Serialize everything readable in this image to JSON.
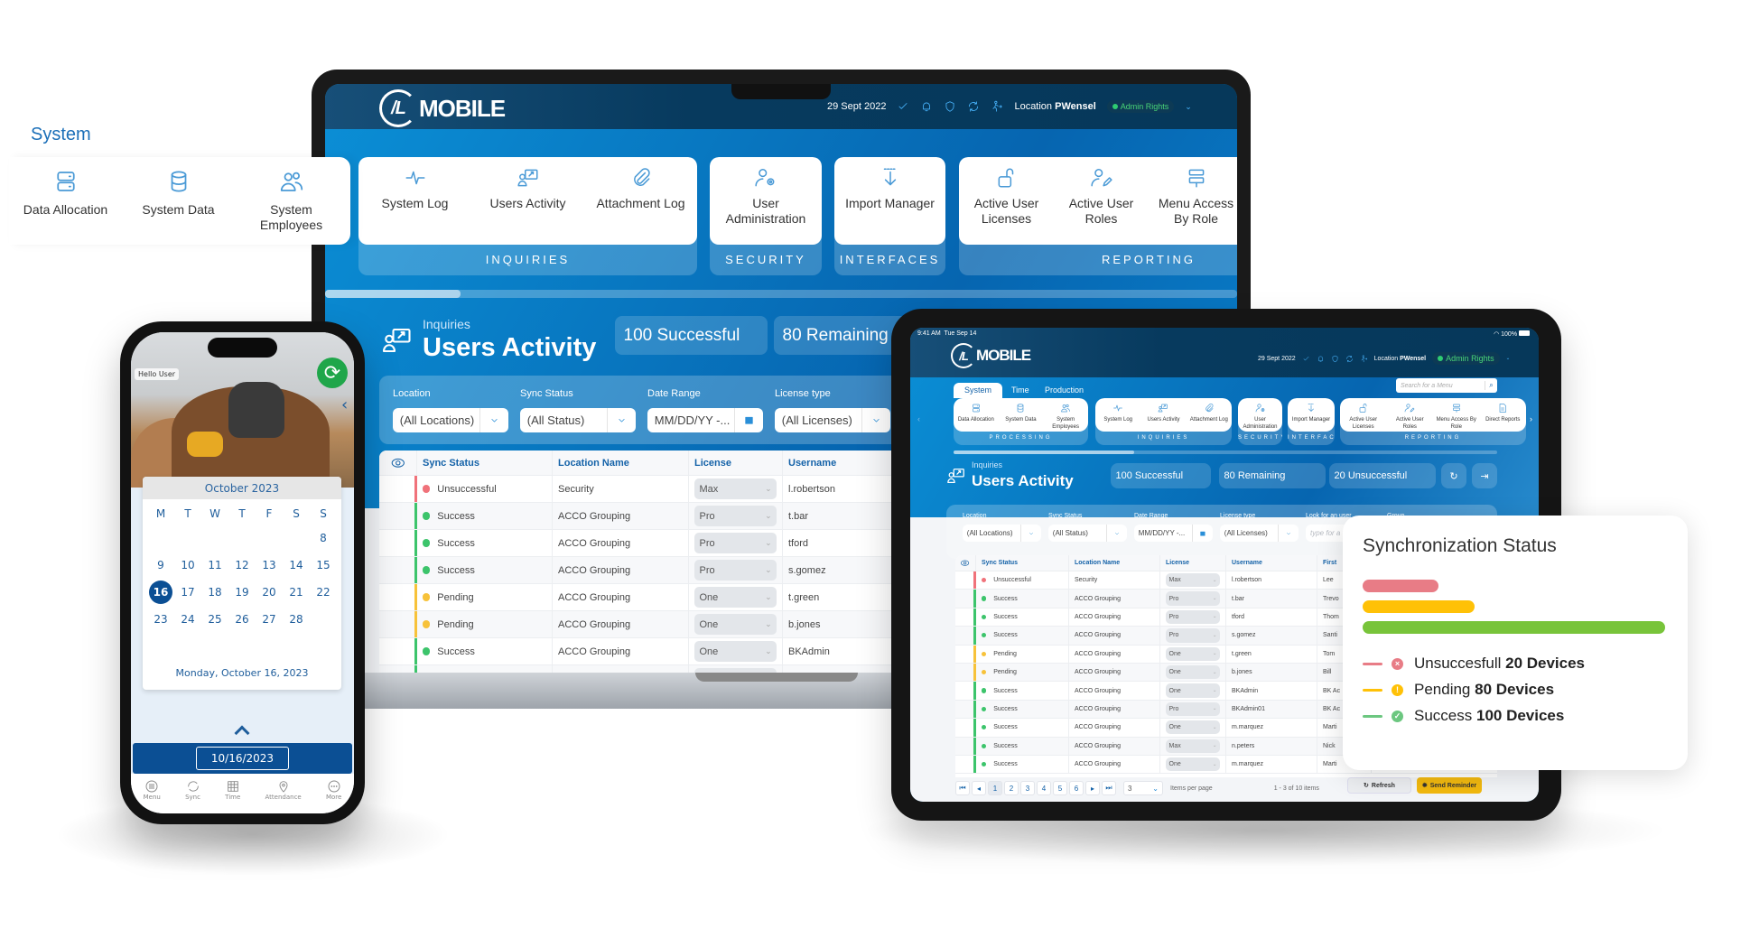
{
  "colors": {
    "brand_blue": "#0a7cc8",
    "header_dark": "#073a5e",
    "success": "#3cc46b",
    "pending": "#f7c23a",
    "unsuccessful": "#f0727a",
    "bar_red": "#e87c86",
    "bar_yellow": "#ffc107",
    "bar_green": "#78c43a",
    "phone_blue": "#0b4f94"
  },
  "floating_panel": {
    "title": "System",
    "items": [
      {
        "label": "Data Allocation",
        "icon": "server-icon"
      },
      {
        "label": "System Data",
        "icon": "database-icon"
      },
      {
        "label": "System Employees",
        "icon": "users-icon"
      }
    ]
  },
  "header": {
    "logo": "/L MOBILE",
    "date": "29 Sept 2022",
    "location_label": "Location",
    "location_value": "PWensel",
    "badge": "Admin Rights"
  },
  "menu_groups": [
    {
      "label": "PROCESSING",
      "items": [
        {
          "label": "Data Allocation",
          "icon": "server-icon"
        },
        {
          "label": "System Data",
          "icon": "database-icon"
        },
        {
          "label": "System Employees",
          "icon": "users-icon"
        }
      ]
    },
    {
      "label": "INQUIRIES",
      "items": [
        {
          "label": "System Log",
          "icon": "pulse-icon"
        },
        {
          "label": "Users Activity",
          "icon": "user-monitor-icon"
        },
        {
          "label": "Attachment Log",
          "icon": "paperclip-icon"
        }
      ]
    },
    {
      "label": "SECURITY",
      "items": [
        {
          "label": "User Administration",
          "icon": "user-gear-icon"
        }
      ]
    },
    {
      "label": "INTERFACES",
      "items": [
        {
          "label": "Import Manager",
          "icon": "import-icon"
        }
      ]
    },
    {
      "label": "REPORTING",
      "items": [
        {
          "label": "Active User Licenses",
          "icon": "lock-open-icon"
        },
        {
          "label": "Active User Roles",
          "icon": "user-edit-icon"
        },
        {
          "label": "Menu Access By Role",
          "icon": "menu-access-icon"
        },
        {
          "label": "Direct Reports",
          "icon": "report-icon"
        }
      ]
    }
  ],
  "page": {
    "section": "Inquiries",
    "title": "Users Activity",
    "stats": [
      {
        "num": "100",
        "label": "Successful"
      },
      {
        "num": "80",
        "label": "Remaining"
      },
      {
        "num": "20",
        "label": "Unsuccessful"
      }
    ]
  },
  "filters": [
    {
      "label": "Location",
      "value": "(All Locations)",
      "icon": "chevron-down-icon"
    },
    {
      "label": "Sync Status",
      "value": "(All Status)",
      "icon": "chevron-down-icon"
    },
    {
      "label": "Date Range",
      "value": "MM/DD/YY -...",
      "icon": "calendar-icon"
    },
    {
      "label": "License type",
      "value": "(All Licenses)",
      "icon": "chevron-down-icon"
    }
  ],
  "user_filter": {
    "label": "Look for an user",
    "placeholder": "type for a"
  },
  "group_filter": {
    "label": "Group"
  },
  "table": {
    "columns": [
      "Sync Status",
      "Location Name",
      "License",
      "Username",
      "First"
    ],
    "rows": [
      {
        "status": "Unsuccessful",
        "type": "unsuccessful",
        "location": "Security",
        "license": "Max",
        "username": "l.robertson",
        "first": "Lee"
      },
      {
        "status": "Success",
        "type": "success",
        "location": "ACCO Grouping",
        "license": "Pro",
        "username": "t.bar",
        "first": "Trevo"
      },
      {
        "status": "Success",
        "type": "success",
        "location": "ACCO Grouping",
        "license": "Pro",
        "username": "tford",
        "first": "Thom"
      },
      {
        "status": "Success",
        "type": "success",
        "location": "ACCO Grouping",
        "license": "Pro",
        "username": "s.gomez",
        "first": "Santi"
      },
      {
        "status": "Pending",
        "type": "pending",
        "location": "ACCO Grouping",
        "license": "One",
        "username": "t.green",
        "first": "Tom"
      },
      {
        "status": "Pending",
        "type": "pending",
        "location": "ACCO Grouping",
        "license": "One",
        "username": "b.jones",
        "first": "Bill"
      },
      {
        "status": "Success",
        "type": "success",
        "location": "ACCO Grouping",
        "license": "One",
        "username": "BKAdmin",
        "first": "BK Ac"
      },
      {
        "status": "Success",
        "type": "success",
        "location": "ACCO Grouping",
        "license": "Pro",
        "username": "BKAdmin01",
        "first": "BK Ac"
      },
      {
        "status": "Success",
        "type": "success",
        "location": "ACCO Grouping",
        "license": "One",
        "username": "m.marquez",
        "first": "Marti"
      },
      {
        "status": "Success",
        "type": "success",
        "location": "ACCO Grouping",
        "license": "Max",
        "username": "n.peters",
        "first": "Nick"
      },
      {
        "status": "Success",
        "type": "success",
        "location": "ACCO Grouping",
        "license": "One",
        "username": "m.marquez",
        "first": "Marti"
      }
    ]
  },
  "tablet": {
    "status_time": "9:41 AM",
    "status_date": "Tue Sep 14",
    "battery": "100%",
    "tabs": [
      {
        "label": "System",
        "active": true
      },
      {
        "label": "Time",
        "active": false
      },
      {
        "label": "Production",
        "active": false
      }
    ],
    "search_placeholder": "Search for a Menu",
    "pagination": {
      "pages": [
        "1",
        "2",
        "3",
        "4",
        "5",
        "6"
      ],
      "current": "1",
      "per_page": "3",
      "per_page_label": "Items per page",
      "summary": "1 - 3 of 10 items"
    },
    "buttons": {
      "refresh": "Refresh",
      "send_reminder": "Send Reminder"
    }
  },
  "sync_card": {
    "title": "Synchronization Status",
    "bars": [
      {
        "type": "unsuccessful",
        "color": "#e87c86",
        "fill": 0.25
      },
      {
        "type": "pending",
        "color": "#ffc107",
        "fill": 0.37
      },
      {
        "type": "success",
        "color": "#78c43a",
        "fill": 1.0
      }
    ],
    "legend": [
      {
        "label": "Unsuccesfull",
        "value": "20 Devices",
        "color": "#e87c86",
        "icon": "x-circle-icon",
        "glyph": "×"
      },
      {
        "label": "Pending",
        "value": "80 Devices",
        "color": "#ffc107",
        "icon": "alert-circle-icon",
        "glyph": "!"
      },
      {
        "label": "Success",
        "value": "100 Devices",
        "color": "#6cc780",
        "icon": "check-circle-icon",
        "glyph": "✓"
      }
    ]
  },
  "phone": {
    "greeting": "Hello User",
    "month": "October 2023",
    "weekdays": [
      "M",
      "T",
      "W",
      "T",
      "F",
      "S",
      "S"
    ],
    "days": [
      "",
      "",
      "",
      "",
      "",
      "",
      "8",
      "9",
      "10",
      "11",
      "12",
      "13",
      "14",
      "15",
      "16",
      "17",
      "18",
      "19",
      "20",
      "21",
      "22",
      "23",
      "24",
      "25",
      "26",
      "27",
      "28",
      ""
    ],
    "selected_day": "16",
    "selected_label": "Monday, October 16, 2023",
    "date_field": "10/16/2023",
    "nav": [
      {
        "label": "Menu",
        "icon": "menu-icon"
      },
      {
        "label": "Sync",
        "icon": "sync-icon"
      },
      {
        "label": "Time",
        "icon": "timesheet-icon"
      },
      {
        "label": "Attendance",
        "icon": "location-pin-icon"
      },
      {
        "label": "More",
        "icon": "more-icon"
      }
    ]
  }
}
